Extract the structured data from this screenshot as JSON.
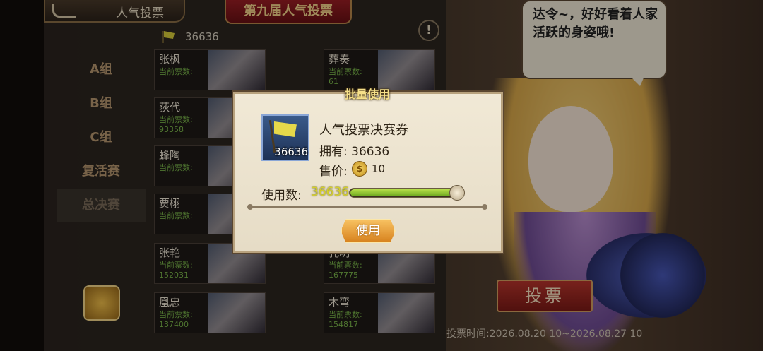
{
  "header": {
    "title": "人气投票",
    "event_title": "第九届人气投票",
    "flag_count": "36636"
  },
  "groups": [
    "A组",
    "B组",
    "C组",
    "复活赛",
    "总决赛"
  ],
  "current_votes_label": "当前票数:",
  "cards_left": [
    {
      "name": "张枫",
      "votes": ""
    },
    {
      "name": "荻代",
      "votes": "93358"
    },
    {
      "name": "蜂陶",
      "votes": ""
    },
    {
      "name": "贾栩",
      "votes": ""
    },
    {
      "name": "张艳",
      "votes": "152031"
    },
    {
      "name": "凰忠",
      "votes": "137400"
    }
  ],
  "cards_right": [
    {
      "name": "葬奏",
      "votes": "61"
    },
    {
      "name": "孔明",
      "votes": "167775"
    },
    {
      "name": "木弯",
      "votes": "154817"
    }
  ],
  "bubble": {
    "text": "达令~，好好看着人家活跃的身姿哦!"
  },
  "vote_button": "投票",
  "vote_time": "投票时间:2026.08.20 10~2026.08.27 10",
  "dialog": {
    "title": "批量使用",
    "item_name": "人气投票决赛券",
    "item_count": "36636",
    "own_label": "拥有: 36636",
    "price_label": "售价:",
    "price_value": "10",
    "use_count_label": "使用数:",
    "use_count_value": "36636",
    "use_fraction": 1.0,
    "use_button": "使用"
  }
}
